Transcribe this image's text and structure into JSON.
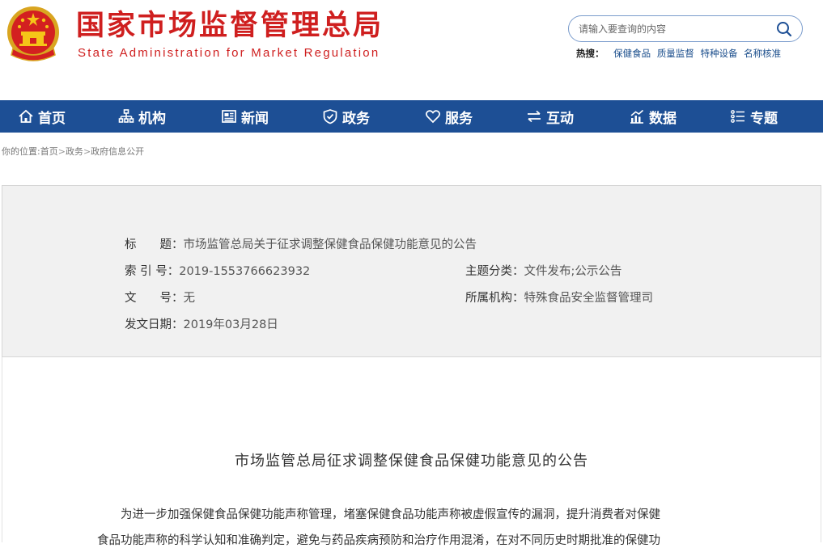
{
  "header": {
    "title_cn": "国家市场监督管理总局",
    "title_en": "State Administration for Market Regulation",
    "brand_color": "#cf1f1f",
    "search": {
      "placeholder": "请输入要查询的内容",
      "icon": "search-icon"
    },
    "hot": {
      "label": "热搜：",
      "links": [
        "保健食品",
        "质量监督",
        "特种设备",
        "名称核准"
      ]
    }
  },
  "nav": {
    "background": "#1d4f95",
    "items": [
      {
        "label": "首页",
        "icon": "home-icon"
      },
      {
        "label": "机构",
        "icon": "org-chart-icon"
      },
      {
        "label": "新闻",
        "icon": "newspaper-icon"
      },
      {
        "label": "政务",
        "icon": "shield-icon"
      },
      {
        "label": "服务",
        "icon": "heart-icon"
      },
      {
        "label": "互动",
        "icon": "exchange-arrows-icon"
      },
      {
        "label": "数据",
        "icon": "chart-icon"
      },
      {
        "label": "专题",
        "icon": "list-icon"
      }
    ]
  },
  "breadcrumb": {
    "prefix": "你的位置:",
    "items": [
      "首页",
      "政务",
      "政府信息公开"
    ],
    "separator": ">"
  },
  "info": {
    "title_label": "标　　题：",
    "title_value": "市场监管总局关于征求调整保健食品保健功能意见的公告",
    "index_label": "索 引 号：",
    "index_value": "2019-1553766623932",
    "topic_label": "主题分类：",
    "topic_value": "文件发布;公示公告",
    "doc_label": "文　　号：",
    "doc_value": "无",
    "org_label": "所属机构：",
    "org_value": "特殊食品安全监督管理司",
    "date_label": "发文日期：",
    "date_value": "2019年03月28日"
  },
  "article": {
    "title": "市场监管总局征求调整保健食品保健功能意见的公告",
    "lines": [
      "为进一步加强保健食品保健功能声称管理，堵塞保健食品功能声称被虚假宣传的漏洞，提升消费者对保健",
      "食品功能声称的科学认知和准确判定，避免与药品疾病预防和治疗作用混淆，在对不同历史时期批准的保健功"
    ]
  }
}
